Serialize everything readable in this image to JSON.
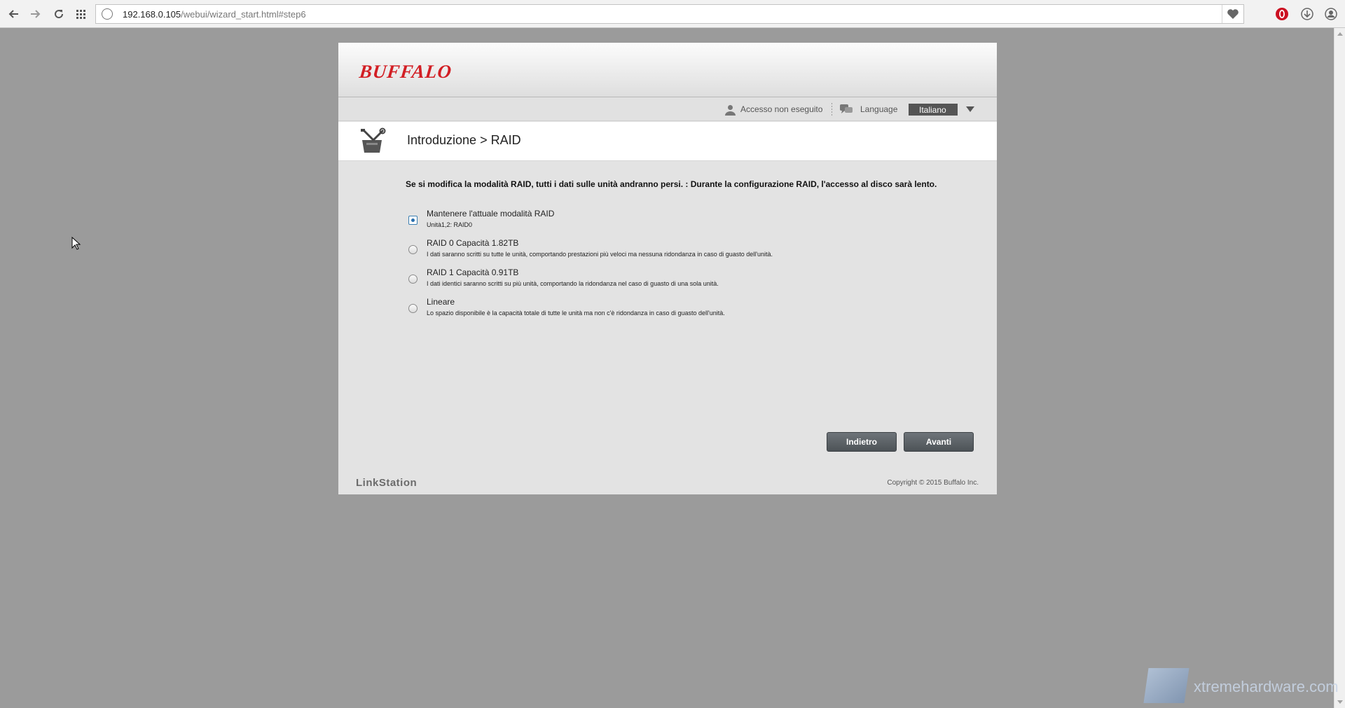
{
  "browser": {
    "url_host": "192.168.0.105",
    "url_path": "/webui/wizard_start.html#step6"
  },
  "header": {
    "logo": "BUFFALO"
  },
  "userbar": {
    "login_status": "Accesso non eseguito",
    "language_label": "Language",
    "language_value": "Italiano"
  },
  "page": {
    "title": "Introduzione > RAID",
    "warning": "Se si modifica la modalità RAID, tutti i dati sulle unità andranno persi.  : Durante la configurazione RAID, l'accesso al disco sarà lento."
  },
  "options": [
    {
      "label": "Mantenere l'attuale modalità RAID",
      "desc": "Unità1,2: RAID0",
      "checked": true
    },
    {
      "label": "RAID 0 Capacità 1.82TB",
      "desc": "I dati saranno scritti su tutte le unità, comportando prestazioni più veloci ma nessuna ridondanza in caso di guasto dell'unità.",
      "checked": false
    },
    {
      "label": "RAID 1 Capacità 0.91TB",
      "desc": "I dati identici saranno scritti su più unità, comportando la ridondanza nel caso di guasto di una sola unità.",
      "checked": false
    },
    {
      "label": "Lineare",
      "desc": "Lo spazio disponibile è la capacità totale di tutte le unità ma non c'è ridondanza in caso di guasto dell'unità.",
      "checked": false
    }
  ],
  "buttons": {
    "back": "Indietro",
    "next": "Avanti"
  },
  "footer": {
    "brand": "LinkStation",
    "copyright": "Copyright © 2015 Buffalo Inc."
  },
  "watermark": "xtremehardware.com"
}
